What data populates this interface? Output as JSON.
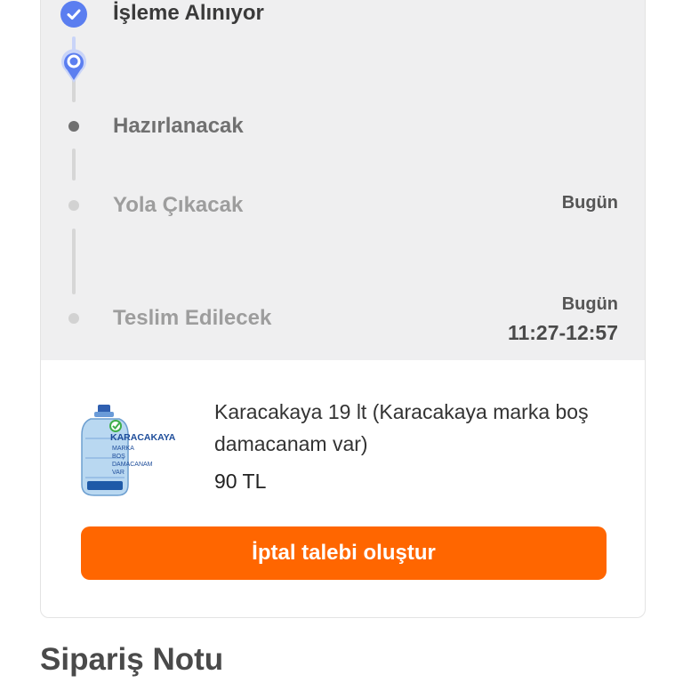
{
  "order_status": {
    "steps": [
      {
        "label": "İşleme Alınıyor",
        "state": "completed",
        "icon": "check-icon"
      },
      {
        "label": "",
        "state": "current",
        "icon": "location-pin-icon"
      },
      {
        "label": "Hazırlanacak",
        "state": "pending"
      },
      {
        "label": "Yola Çıkacak",
        "state": "pending",
        "date": "Bugün"
      },
      {
        "label": "Teslim Edilecek",
        "state": "pending",
        "date": "Bugün",
        "time_range": "11:27-12:57"
      }
    ]
  },
  "product": {
    "image_brand": "KARACAKAYA",
    "image_caption": [
      "MARKA",
      "BOŞ",
      "DAMACANAM",
      "VAR"
    ],
    "name": "Karacakaya 19 lt (Karacakaya marka boş damacanam var)",
    "price": "90 TL"
  },
  "actions": {
    "cancel_label": "İptal talebi oluştur"
  },
  "order_note": {
    "title": "Sipariş Notu"
  },
  "colors": {
    "accent_orange": "#ff6600",
    "timeline_blue": "#5b7ef0",
    "timeline_background": "#efeff0"
  }
}
